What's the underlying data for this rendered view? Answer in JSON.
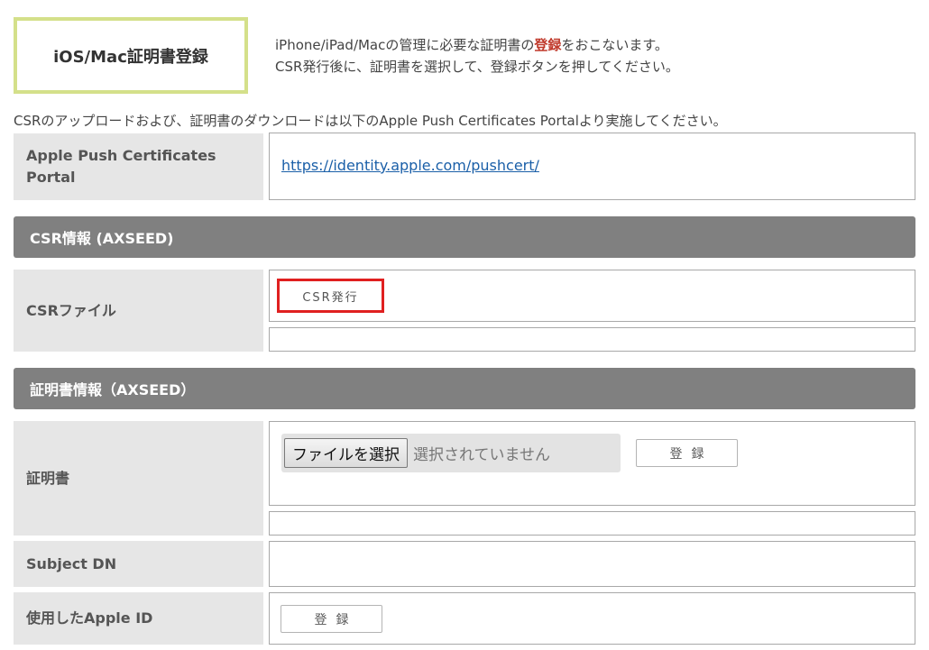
{
  "header": {
    "title": "iOS/Mac証明書登録",
    "intro_line1_before": "iPhone/iPad/Macの管理に必要な証明書の",
    "intro_line1_highlight": "登録",
    "intro_line1_after": "をおこないます。",
    "intro_line2": "CSR発行後に、証明書を選択して、登録ボタンを押してください。"
  },
  "note": "CSRのアップロードおよび、証明書のダウンロードは以下のApple Push Certificates Portalより実施してください。",
  "portal": {
    "label": "Apple Push Certificates Portal",
    "url": "https://identity.apple.com/pushcert/"
  },
  "csr_section": {
    "title": "CSR情報 (AXSEED)",
    "file_label": "CSRファイル",
    "issue_button": "CSR発行"
  },
  "cert_section": {
    "title": "証明書情報（AXSEED）",
    "cert_label": "証明書",
    "choose_file_button": "ファイルを選択",
    "file_status": "選択されていません",
    "register_button": "登録",
    "subject_dn_label": "Subject DN",
    "apple_id_label": "使用したApple ID",
    "apple_id_register_button": "登録"
  },
  "colors": {
    "title_border": "#d4e08a",
    "section_bar": "#808080",
    "label_bg": "#e6e6e6",
    "highlight": "#c0392b",
    "csr_button_border": "#e02020",
    "link": "#1a5fa8"
  }
}
